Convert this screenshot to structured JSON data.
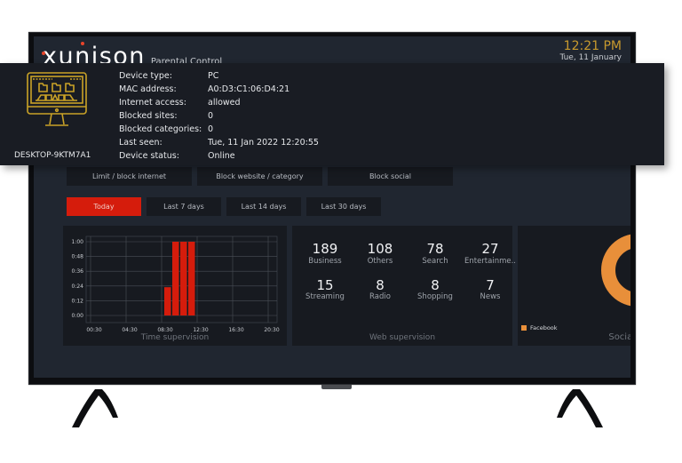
{
  "header": {
    "brand": "xunison",
    "subtitle": "Parental Control",
    "time": "12:21 PM",
    "date": "Tue, 11 January"
  },
  "device_popup": {
    "name": "DESKTOP-9KTM7A1",
    "icon": "desktop-computer-icon",
    "fields": [
      {
        "label": "Device type:",
        "value": "PC"
      },
      {
        "label": "MAC address:",
        "value": "A0:D3:C1:06:D4:21"
      },
      {
        "label": "Internet access:",
        "value": "allowed"
      },
      {
        "label": "Blocked sites:",
        "value": "0"
      },
      {
        "label": "Blocked categories:",
        "value": "0"
      },
      {
        "label": "Last seen:",
        "value": "Tue, 11 Jan 2022 12:20:55"
      },
      {
        "label": "Device status:",
        "value": "Online"
      }
    ]
  },
  "actions": [
    {
      "label": "Limit / block internet"
    },
    {
      "label": "Block website / category"
    },
    {
      "label": "Block social"
    }
  ],
  "ranges": [
    {
      "label": "Today",
      "active": true
    },
    {
      "label": "Last 7 days",
      "active": false
    },
    {
      "label": "Last 14 days",
      "active": false
    },
    {
      "label": "Last 30 days",
      "active": false
    }
  ],
  "time_supervision": {
    "caption": "Time supervision",
    "bar_color": "#d51c0c"
  },
  "web_supervision": {
    "caption": "Web supervision",
    "stats": [
      {
        "value": "189",
        "label": "Business"
      },
      {
        "value": "108",
        "label": "Others"
      },
      {
        "value": "78",
        "label": "Search"
      },
      {
        "value": "27",
        "label": "Entertainme.."
      },
      {
        "value": "15",
        "label": "Streaming"
      },
      {
        "value": "8",
        "label": "Radio"
      },
      {
        "value": "8",
        "label": "Shopping"
      },
      {
        "value": "7",
        "label": "News"
      }
    ]
  },
  "social": {
    "caption": "Social",
    "legend": [
      {
        "label": "Facebook",
        "color": "#e88f3a"
      }
    ]
  },
  "colors": {
    "accent_red": "#d51c0c",
    "clock_gold": "#c89a2e",
    "icon_gold": "#c9a227",
    "social_orange": "#e88f3a"
  },
  "chart_data": [
    {
      "type": "bar",
      "title": "Time supervision",
      "xlabel": "",
      "ylabel": "",
      "x_ticks": [
        "00:30",
        "04:30",
        "08:30",
        "12:30",
        "16:30",
        "20:30"
      ],
      "y_ticks": [
        "0:00",
        "0:12",
        "0:24",
        "0:36",
        "0:48",
        "1:00"
      ],
      "ylim_minutes": [
        0,
        60
      ],
      "grid": true,
      "categories": [
        "08:30",
        "09:30",
        "10:30",
        "11:30"
      ],
      "values_minutes": [
        23,
        60,
        60,
        60
      ]
    },
    {
      "type": "pie",
      "title": "Social",
      "labels": [
        "Facebook"
      ],
      "values": [
        100
      ],
      "donut": true,
      "legend": "bottom-left"
    }
  ]
}
